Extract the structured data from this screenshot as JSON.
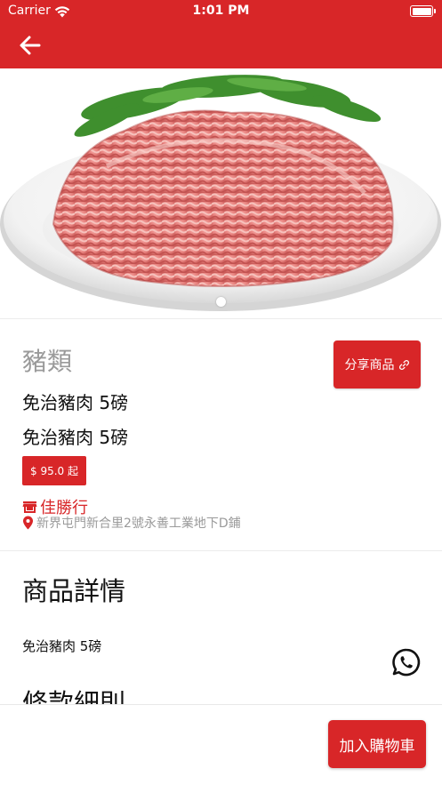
{
  "status_bar": {
    "carrier": "Carrier",
    "time": "1:01 PM",
    "battery_level": 1.0
  },
  "header": {
    "back_icon": "arrow-left-icon"
  },
  "carousel": {
    "image_subject": "minced pork on a white plate with herbs",
    "page_count": 1,
    "current_page": 1
  },
  "product": {
    "category": "豬類",
    "title": "免治豬肉 5磅",
    "subtitle": "免治豬肉 5磅",
    "price": "$ 95.0 起",
    "share_label": "分享商品",
    "share_icon": "link-icon",
    "shop_name": "佳勝行",
    "shop_icon": "store-icon",
    "address": "新界屯門新合里2號永善工業地下D鋪",
    "address_icon": "location-pin-icon"
  },
  "details": {
    "section_title": "商品詳情",
    "description": "免治豬肉 5磅",
    "terms_title": "條款細則"
  },
  "floating": {
    "whatsapp_icon": "whatsapp-icon"
  },
  "footer": {
    "add_to_cart_label": "加入購物車"
  },
  "colors": {
    "brand_red": "#d82628",
    "muted_gray": "#9a9a9a"
  }
}
